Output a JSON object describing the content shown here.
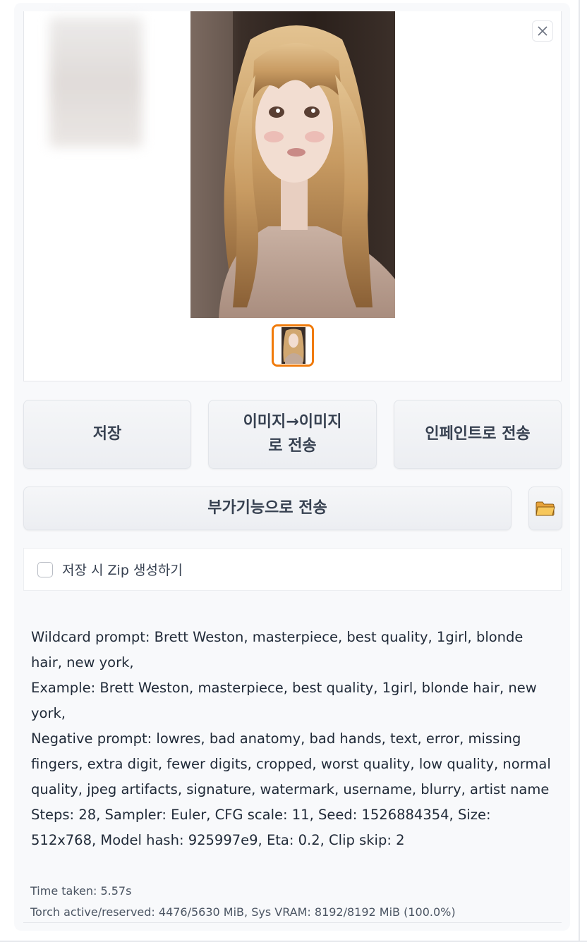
{
  "buttons": {
    "save": "저장",
    "img2img_line1": "이미지→이미지",
    "img2img_line2": "로 전송",
    "inpaint": "인페인트로 전송",
    "extras": "부가기능으로 전송",
    "folder_icon": "folder-icon"
  },
  "checkbox": {
    "label": "저장 시 Zip 생성하기",
    "checked": false
  },
  "gallery": {
    "close_icon": "close-icon",
    "selected_index": 0
  },
  "info": {
    "wildcard_prompt": "Wildcard prompt: Brett Weston, masterpiece, best quality, 1girl, blonde hair, new york,",
    "example": "Example: Brett Weston, masterpiece, best quality, 1girl, blonde hair, new york,",
    "negative_prompt": "Negative prompt: lowres, bad anatomy, bad hands, text, error, missing fingers, extra digit, fewer digits, cropped, worst quality, low quality, normal quality, jpeg artifacts, signature, watermark, username, blurry, artist name",
    "params": "Steps: 28, Sampler: Euler, CFG scale: 11, Seed: 1526884354, Size: 512x768, Model hash: 925997e9, Eta: 0.2, Clip skip: 2"
  },
  "stats": {
    "time_taken": "Time taken: 5.57s",
    "vram": "Torch active/reserved: 4476/5630 MiB, Sys VRAM: 8192/8192 MiB (100.0%)"
  },
  "colors": {
    "selected_border": "#f07a0a",
    "panel_bg": "#f8f9fb"
  }
}
